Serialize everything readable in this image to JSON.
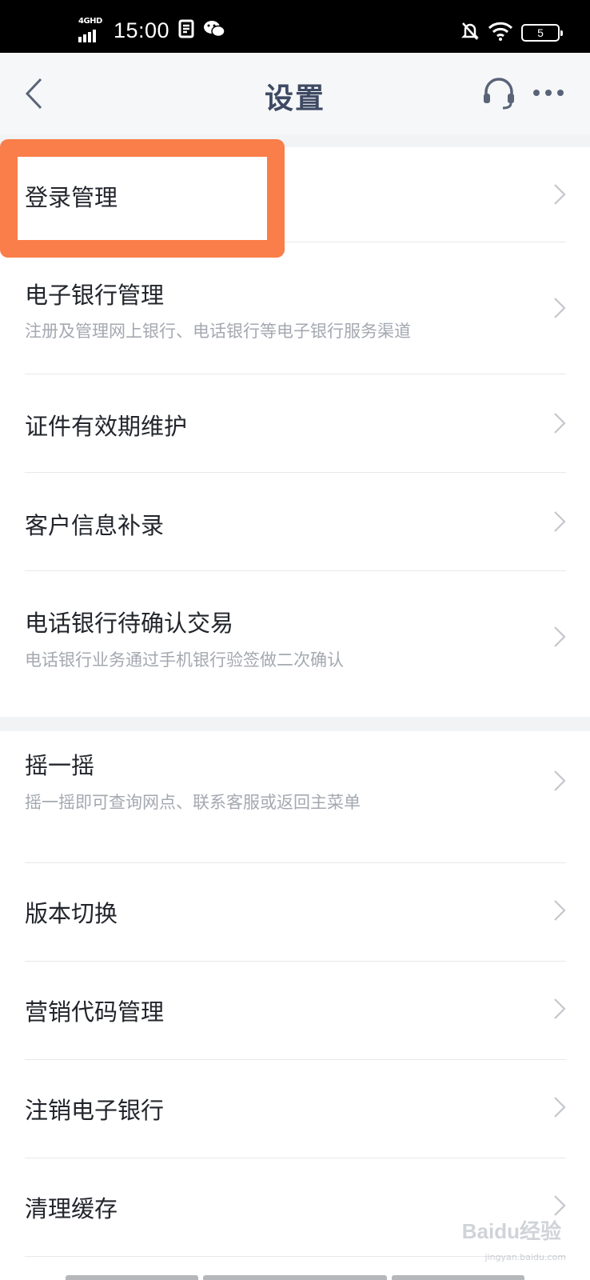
{
  "status_bar": {
    "network": "4GHD",
    "time": "15:00",
    "battery": "5",
    "icons": [
      "signal-icon",
      "screenshot-icon",
      "wechat-icon",
      "mute-bell-icon",
      "wifi-icon",
      "battery-icon"
    ]
  },
  "nav": {
    "title": "设置",
    "back_icon": "chevron-left-icon",
    "service_icon": "headset-icon",
    "more_icon": "more-dots-icon"
  },
  "groups": [
    {
      "items": [
        {
          "title": "登录管理"
        },
        {
          "title": "电子银行管理",
          "subtitle": "注册及管理网上银行、电话银行等电子银行服务渠道"
        },
        {
          "title": "证件有效期维护"
        },
        {
          "title": "客户信息补录"
        },
        {
          "title": "电话银行待确认交易",
          "subtitle": "电话银行业务通过手机银行验签做二次确认"
        }
      ]
    },
    {
      "items": [
        {
          "title": "摇一摇",
          "subtitle": "摇一摇即可查询网点、联系客服或返回主菜单"
        },
        {
          "title": "版本切换"
        },
        {
          "title": "营销代码管理"
        },
        {
          "title": "注销电子银行"
        },
        {
          "title": "清理缓存"
        }
      ]
    }
  ],
  "watermark": {
    "text": "Baidu经验",
    "sub": "jingyan.baidu.com"
  },
  "colors": {
    "highlight": "#f97e4a",
    "nav_title": "#3e4a63",
    "subtitle": "#a4a8b0",
    "chevron": "#c4c7cc"
  }
}
